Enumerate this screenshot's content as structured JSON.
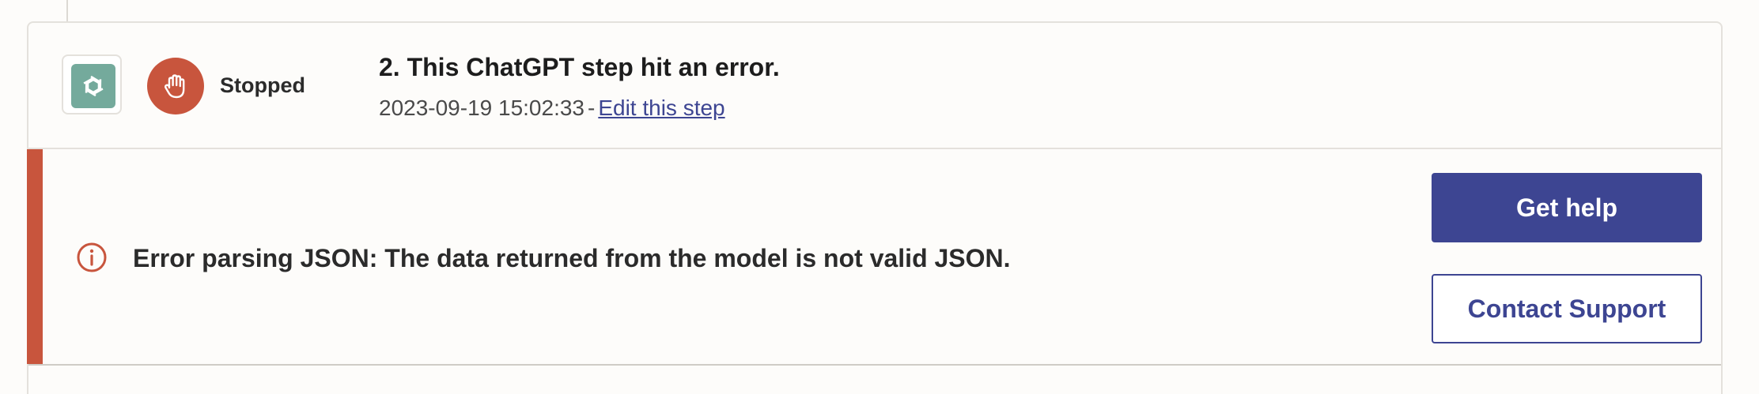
{
  "step": {
    "app_icon": "chatgpt-openai-logo",
    "status_icon": "hand-stop-icon",
    "status_label": "Stopped",
    "title": "2. This ChatGPT step hit an error.",
    "timestamp": "2023-09-19 15:02:33",
    "separator": "-",
    "edit_link": "Edit this step"
  },
  "error": {
    "icon": "info-circle-icon",
    "message": "Error parsing JSON: The data returned from the model is not valid JSON."
  },
  "actions": {
    "get_help_label": "Get help",
    "contact_support_label": "Contact Support"
  },
  "colors": {
    "error_accent": "#c8553d",
    "primary_button": "#3d4592",
    "app_icon_bg": "#74aa9c"
  }
}
